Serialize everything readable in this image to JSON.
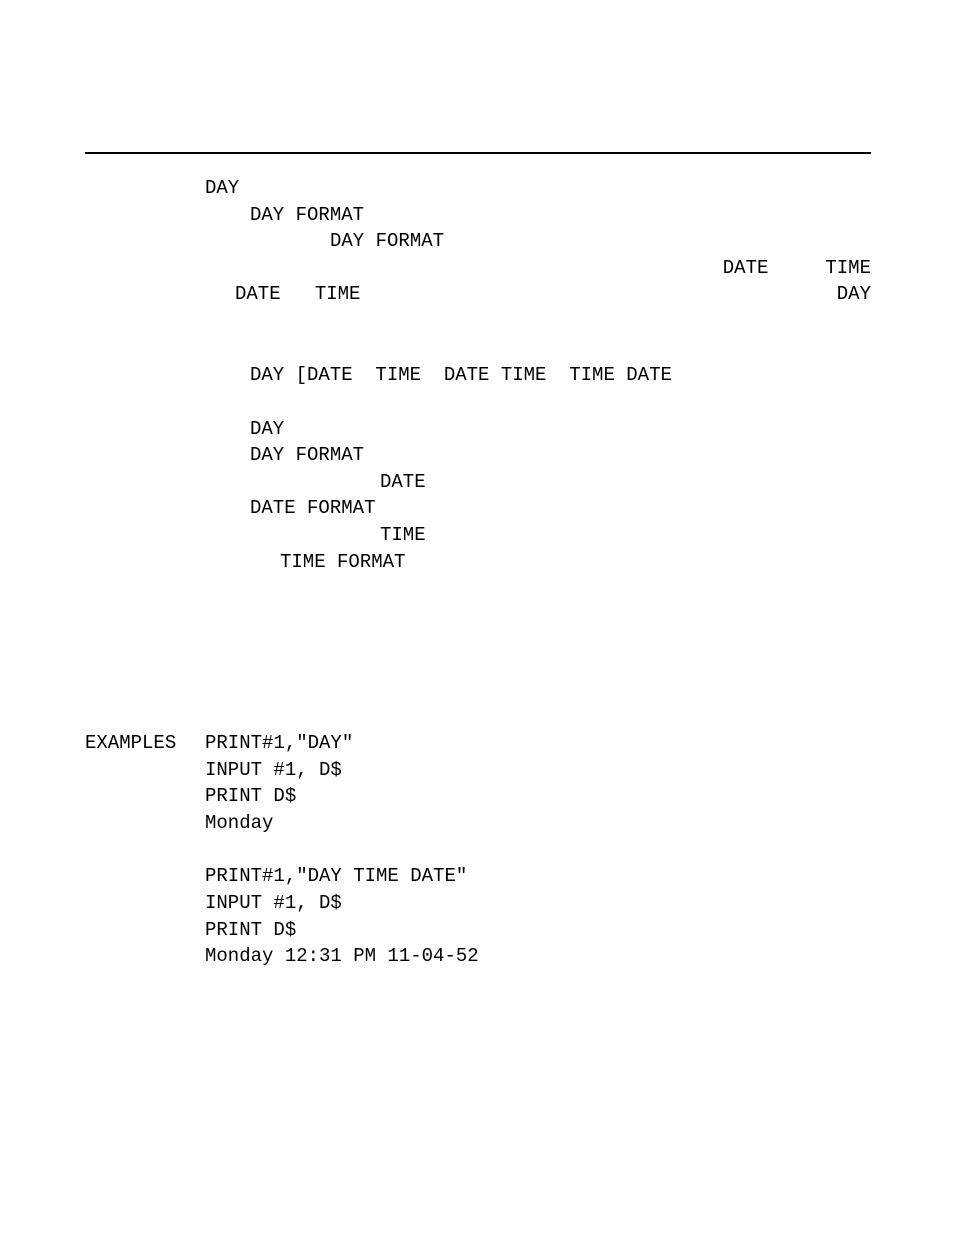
{
  "line1": "DAY",
  "line2": "DAY FORMAT",
  "line3": "DAY FORMAT",
  "line4": "DATE     TIME",
  "line5_left": "DATE   TIME",
  "line5_right": "DAY",
  "syntax": "DAY [DATE  TIME  DATE TIME  TIME DATE",
  "block": {
    "l1": "DAY",
    "l2": "DAY FORMAT",
    "l3": "DATE",
    "l4": "DATE FORMAT",
    "l5": "TIME",
    "l6": "TIME FORMAT"
  },
  "examples_label": "EXAMPLES",
  "ex1": {
    "l1": "PRINT#1,\"DAY\"",
    "l2": "INPUT #1, D$",
    "l3": "PRINT D$",
    "l4": "Monday"
  },
  "ex2": {
    "l1": "PRINT#1,\"DAY TIME DATE\"",
    "l2": "INPUT #1, D$",
    "l3": "PRINT D$",
    "l4": "Monday 12:31 PM 11-04-52"
  }
}
